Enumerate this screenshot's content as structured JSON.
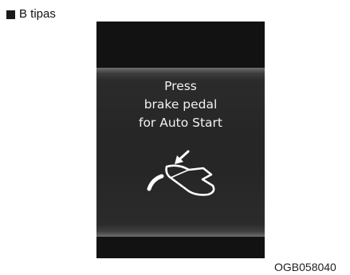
{
  "heading": {
    "label": "B tipas"
  },
  "display": {
    "message_lines": [
      "Press",
      "brake pedal",
      "for Auto Start"
    ],
    "icon": "brake-pedal-press-icon"
  },
  "figure_code": "OGB058040"
}
